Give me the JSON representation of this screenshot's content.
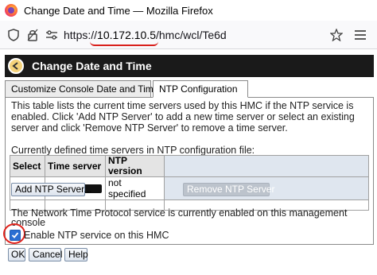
{
  "window": {
    "title": "Change Date and Time — Mozilla Firefox"
  },
  "urlbar": {
    "scheme": "https://",
    "host": "10.172.10.5",
    "path": "/hmc/wcl/Te6d"
  },
  "header": {
    "title": "Change Date and Time"
  },
  "tabs": [
    {
      "label": "Customize Console Date and Time",
      "selected": false
    },
    {
      "label": "NTP Configuration",
      "selected": true
    }
  ],
  "main": {
    "description": "This table lists the current time servers used by this HMC if the NTP service is enabled. Click 'Add NTP Server' to add a new time server or select an existing server and click 'Remove NTP Server' to remove a time server.",
    "table_caption": "Currently defined time servers in NTP configuration file:",
    "table": {
      "columns": [
        "Select",
        "Time server",
        "NTP version"
      ],
      "rows": [
        {
          "time_server": "",
          "ntp_version": "not specified"
        }
      ]
    },
    "add_button": "Add NTP Server...",
    "remove_button": "Remove NTP Server",
    "status": "The Network Time Protocol service is currently enabled on this management console",
    "checkbox_label": "Enable NTP service on this HMC",
    "checkbox_checked": true
  },
  "footer": {
    "ok": "OK",
    "cancel": "Cancel",
    "help": "Help"
  },
  "colors": {
    "header_bg": "#1a1a1a",
    "checkbox_accent": "#2a6ed2",
    "annotation_red": "#e0231c"
  }
}
